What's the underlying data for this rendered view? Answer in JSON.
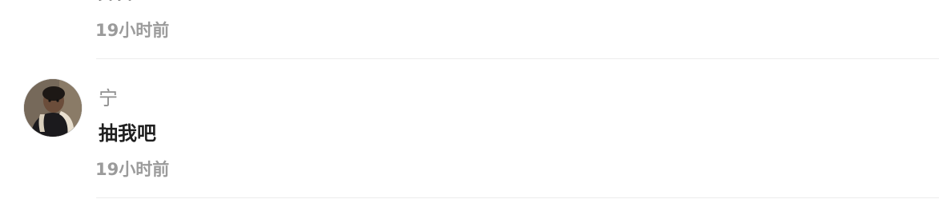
{
  "comments": [
    {
      "content": "鼻鼻",
      "time": "19小时前"
    },
    {
      "username": "宁",
      "content": "抽我吧",
      "time": "19小时前",
      "avatar_icon": "user-photo-avatar"
    }
  ]
}
